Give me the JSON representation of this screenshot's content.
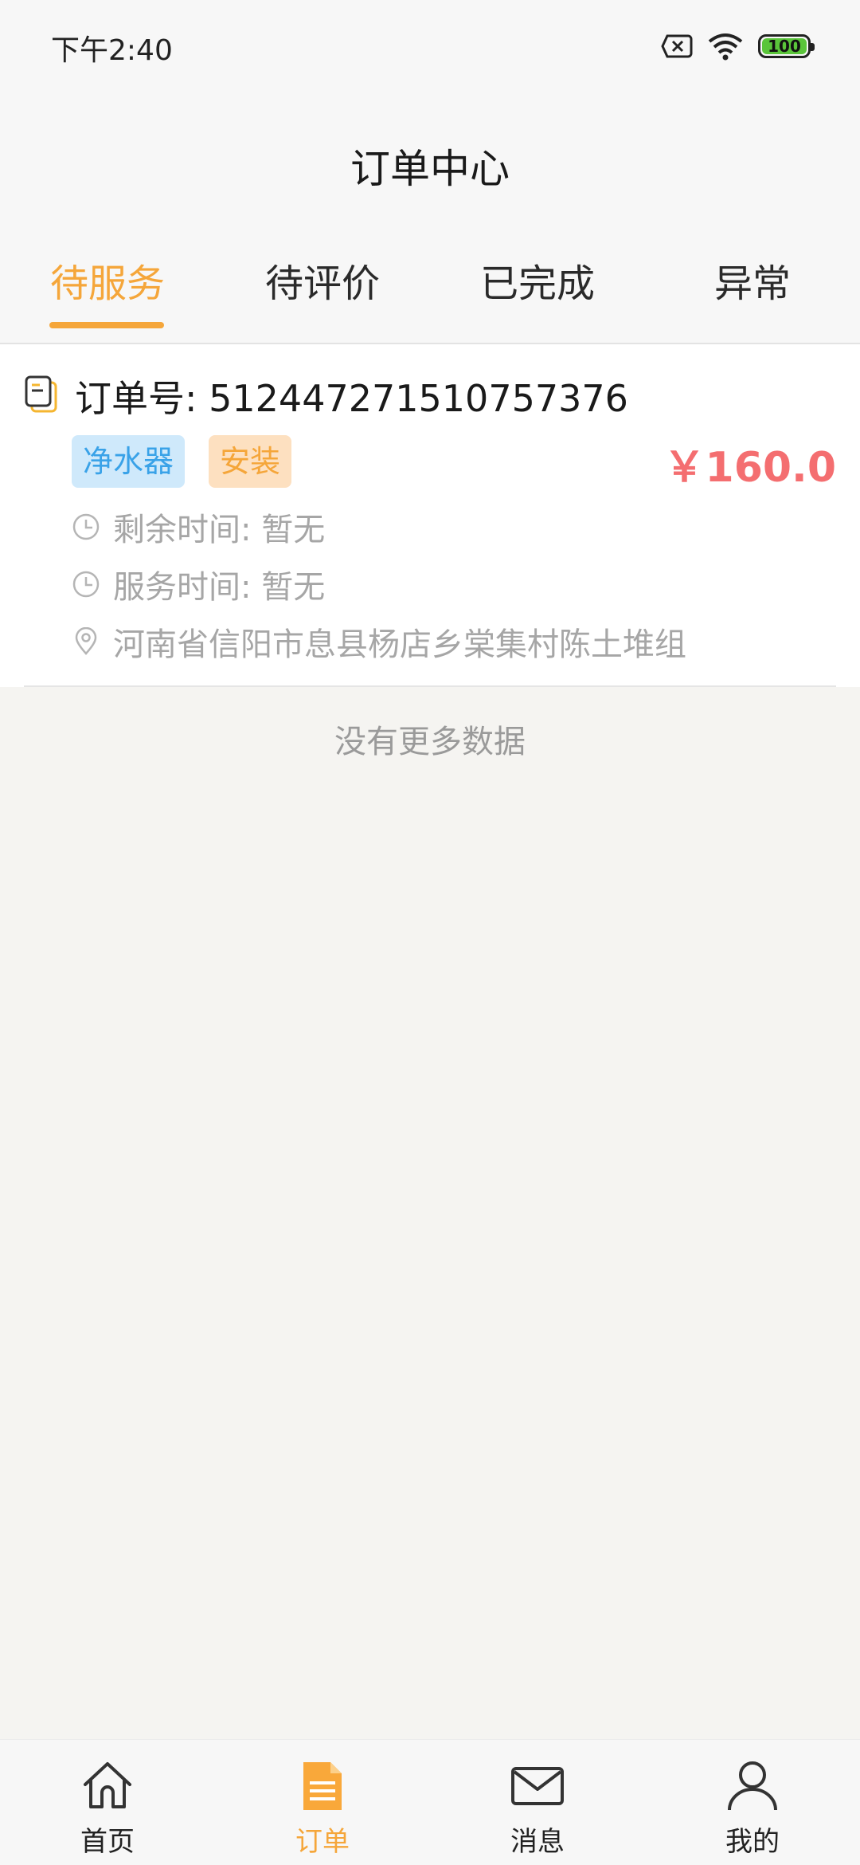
{
  "status_bar": {
    "time": "下午2:40",
    "battery": "100",
    "icons": [
      "sim-off-icon",
      "wifi-icon",
      "battery-icon"
    ]
  },
  "header": {
    "title": "订单中心"
  },
  "tabs": [
    {
      "label": "待服务",
      "active": true
    },
    {
      "label": "待评价",
      "active": false
    },
    {
      "label": "已完成",
      "active": false
    },
    {
      "label": "异常",
      "active": false
    }
  ],
  "order": {
    "number_label": "订单号:",
    "number": "512447271510757376",
    "tags": [
      "净水器",
      "安装"
    ],
    "price": "￥160.0",
    "remaining_time": "剩余时间: 暂无",
    "service_time": "服务时间: 暂无",
    "address": "河南省信阳市息县杨店乡棠集村陈土堆组"
  },
  "list_footer": "没有更多数据",
  "bottom_nav": [
    {
      "label": "首页",
      "icon": "home-icon",
      "active": false
    },
    {
      "label": "订单",
      "icon": "order-doc-icon",
      "active": true
    },
    {
      "label": "消息",
      "icon": "mail-icon",
      "active": false
    },
    {
      "label": "我的",
      "icon": "user-icon",
      "active": false
    }
  ],
  "colors": {
    "accent": "#f5a63a",
    "price": "#f46e70",
    "tag_product_bg": "#cfe9fb",
    "tag_product_text": "#39a2e8",
    "tag_service_bg": "#fde0c0",
    "muted_text": "#a6a6a6"
  }
}
